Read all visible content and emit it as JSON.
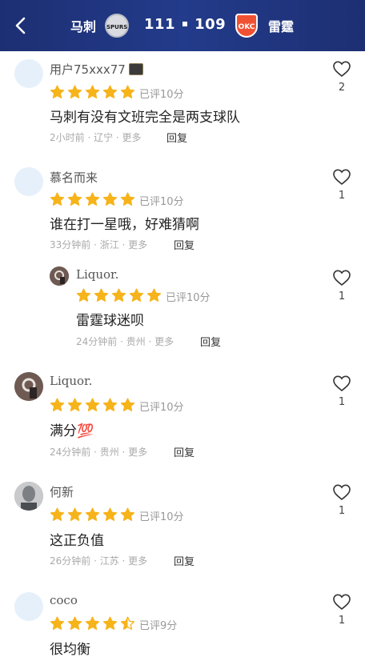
{
  "header": {
    "back_icon": "chevron-left-icon",
    "team_left": "马刺",
    "team_left_logo": "SPURS",
    "score_left": "111",
    "score_right": "109",
    "team_right_logo": "OKC",
    "team_right": "雷霆"
  },
  "comments": [
    {
      "user": "用户75xxx77",
      "rating": 5,
      "score_label": "已评10分",
      "content": "马刺有没有文班完全是两支球队",
      "meta": "2小时前 · 辽宁 · 更多",
      "reply_label": "回复",
      "likes": "2"
    },
    {
      "user": "慕名而来",
      "rating": 5,
      "score_label": "已评10分",
      "content": "谁在打一星哦，好难猜啊",
      "meta": "33分钟前 · 浙江 · 更多",
      "reply_label": "回复",
      "likes": "1"
    },
    {
      "user": "Liquor.",
      "rating": 5,
      "score_label": "已评10分",
      "content": "雷霆球迷呗",
      "meta": "24分钟前 · 贵州 · 更多",
      "reply_label": "回复",
      "likes": "1"
    },
    {
      "user": "Liquor.",
      "rating": 5,
      "score_label": "已评10分",
      "content": "满分💯",
      "meta": "24分钟前 · 贵州 · 更多",
      "reply_label": "回复",
      "likes": "1"
    },
    {
      "user": "何新",
      "rating": 5,
      "score_label": "已评10分",
      "content": "这正负值",
      "meta": "26分钟前 · 江苏 · 更多",
      "reply_label": "回复",
      "likes": "1"
    },
    {
      "user": "coco",
      "rating": 4.5,
      "score_label": "已评9分",
      "content": "很均衡",
      "likes": "1"
    }
  ],
  "colors": {
    "header_bg": "#223b8a",
    "star": "#f6b31a",
    "star_empty": "#e3e3e3"
  }
}
